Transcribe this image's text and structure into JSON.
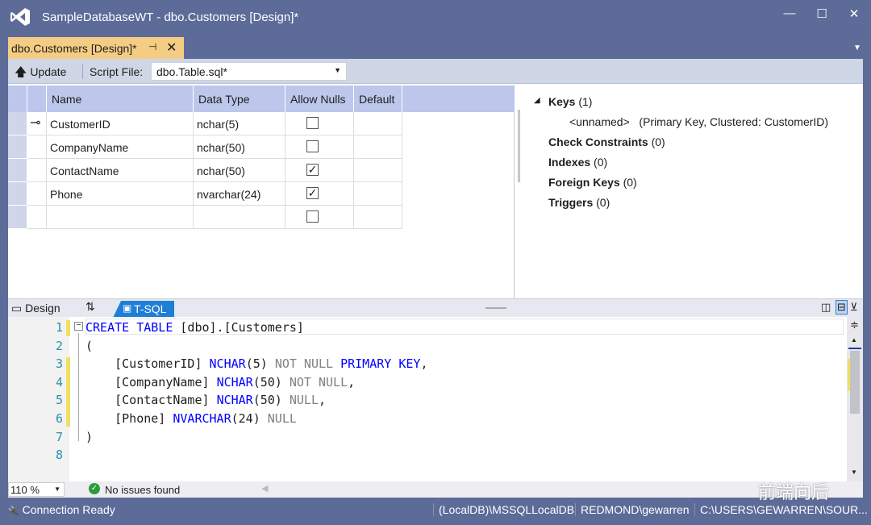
{
  "window": {
    "title": "SampleDatabaseWT - dbo.Customers [Design]*",
    "minimize": "—",
    "maximize": "☐",
    "close": "✕"
  },
  "doc_tab": {
    "label": "dbo.Customers [Design]*",
    "pin": "⊣",
    "close": "✕"
  },
  "toolbar": {
    "update_label": "Update",
    "script_file_label": "Script File:",
    "script_file_value": "dbo.Table.sql*"
  },
  "grid": {
    "columns": [
      "Name",
      "Data Type",
      "Allow Nulls",
      "Default"
    ],
    "rows": [
      {
        "name": "CustomerID",
        "type": "nchar(5)",
        "allow_nulls": false,
        "key": true
      },
      {
        "name": "CompanyName",
        "type": "nchar(50)",
        "allow_nulls": false
      },
      {
        "name": "ContactName",
        "type": "nchar(50)",
        "allow_nulls": true
      },
      {
        "name": "Phone",
        "type": "nvarchar(24)",
        "allow_nulls": true
      },
      {
        "name": "",
        "type": "",
        "allow_nulls": false
      }
    ]
  },
  "properties": {
    "keys": {
      "label": "Keys",
      "count": "(1)",
      "child": "<unnamed>",
      "child_desc": "(Primary Key, Clustered: CustomerID)"
    },
    "check": {
      "label": "Check Constraints",
      "count": "(0)"
    },
    "indexes": {
      "label": "Indexes",
      "count": "(0)"
    },
    "foreign": {
      "label": "Foreign Keys",
      "count": "(0)"
    },
    "triggers": {
      "label": "Triggers",
      "count": "(0)"
    }
  },
  "view_tabs": {
    "design": "Design",
    "swap": "⇅",
    "tsql": "T-SQL"
  },
  "code_lines": [
    [
      {
        "t": "CREATE TABLE",
        "c": "kw"
      },
      {
        "t": " [dbo].[Customers]"
      }
    ],
    [
      {
        "t": "("
      }
    ],
    [
      {
        "t": "    [CustomerID] "
      },
      {
        "t": "NCHAR",
        "c": "kw"
      },
      {
        "t": "(5) "
      },
      {
        "t": "NOT NULL",
        "c": "gy"
      },
      {
        "t": " "
      },
      {
        "t": "PRIMARY KEY",
        "c": "kw"
      },
      {
        "t": ","
      }
    ],
    [
      {
        "t": "    [CompanyName] "
      },
      {
        "t": "NCHAR",
        "c": "kw"
      },
      {
        "t": "(50) "
      },
      {
        "t": "NOT NULL",
        "c": "gy"
      },
      {
        "t": ","
      }
    ],
    [
      {
        "t": "    [ContactName] "
      },
      {
        "t": "NCHAR",
        "c": "kw"
      },
      {
        "t": "(50) "
      },
      {
        "t": "NULL",
        "c": "gy"
      },
      {
        "t": ","
      }
    ],
    [
      {
        "t": "    [Phone] "
      },
      {
        "t": "NVARCHAR",
        "c": "kw"
      },
      {
        "t": "(24) "
      },
      {
        "t": "NULL",
        "c": "gy"
      }
    ],
    [
      {
        "t": ")"
      }
    ],
    [
      {
        "t": ""
      }
    ]
  ],
  "editor_status": {
    "zoom": "110 %",
    "issues": "No issues found"
  },
  "status_bar": {
    "connection": "Connection Ready",
    "server": "(LocalDB)\\MSSQLLocalDB",
    "user": "REDMOND\\gewarren",
    "path": "C:\\USERS\\GEWARREN\\SOUR..."
  },
  "watermark": "前端向后",
  "colors": {
    "accent": "#5d6b99",
    "tab": "#f5cc84",
    "tsql_tab": "#1f7fd6"
  }
}
